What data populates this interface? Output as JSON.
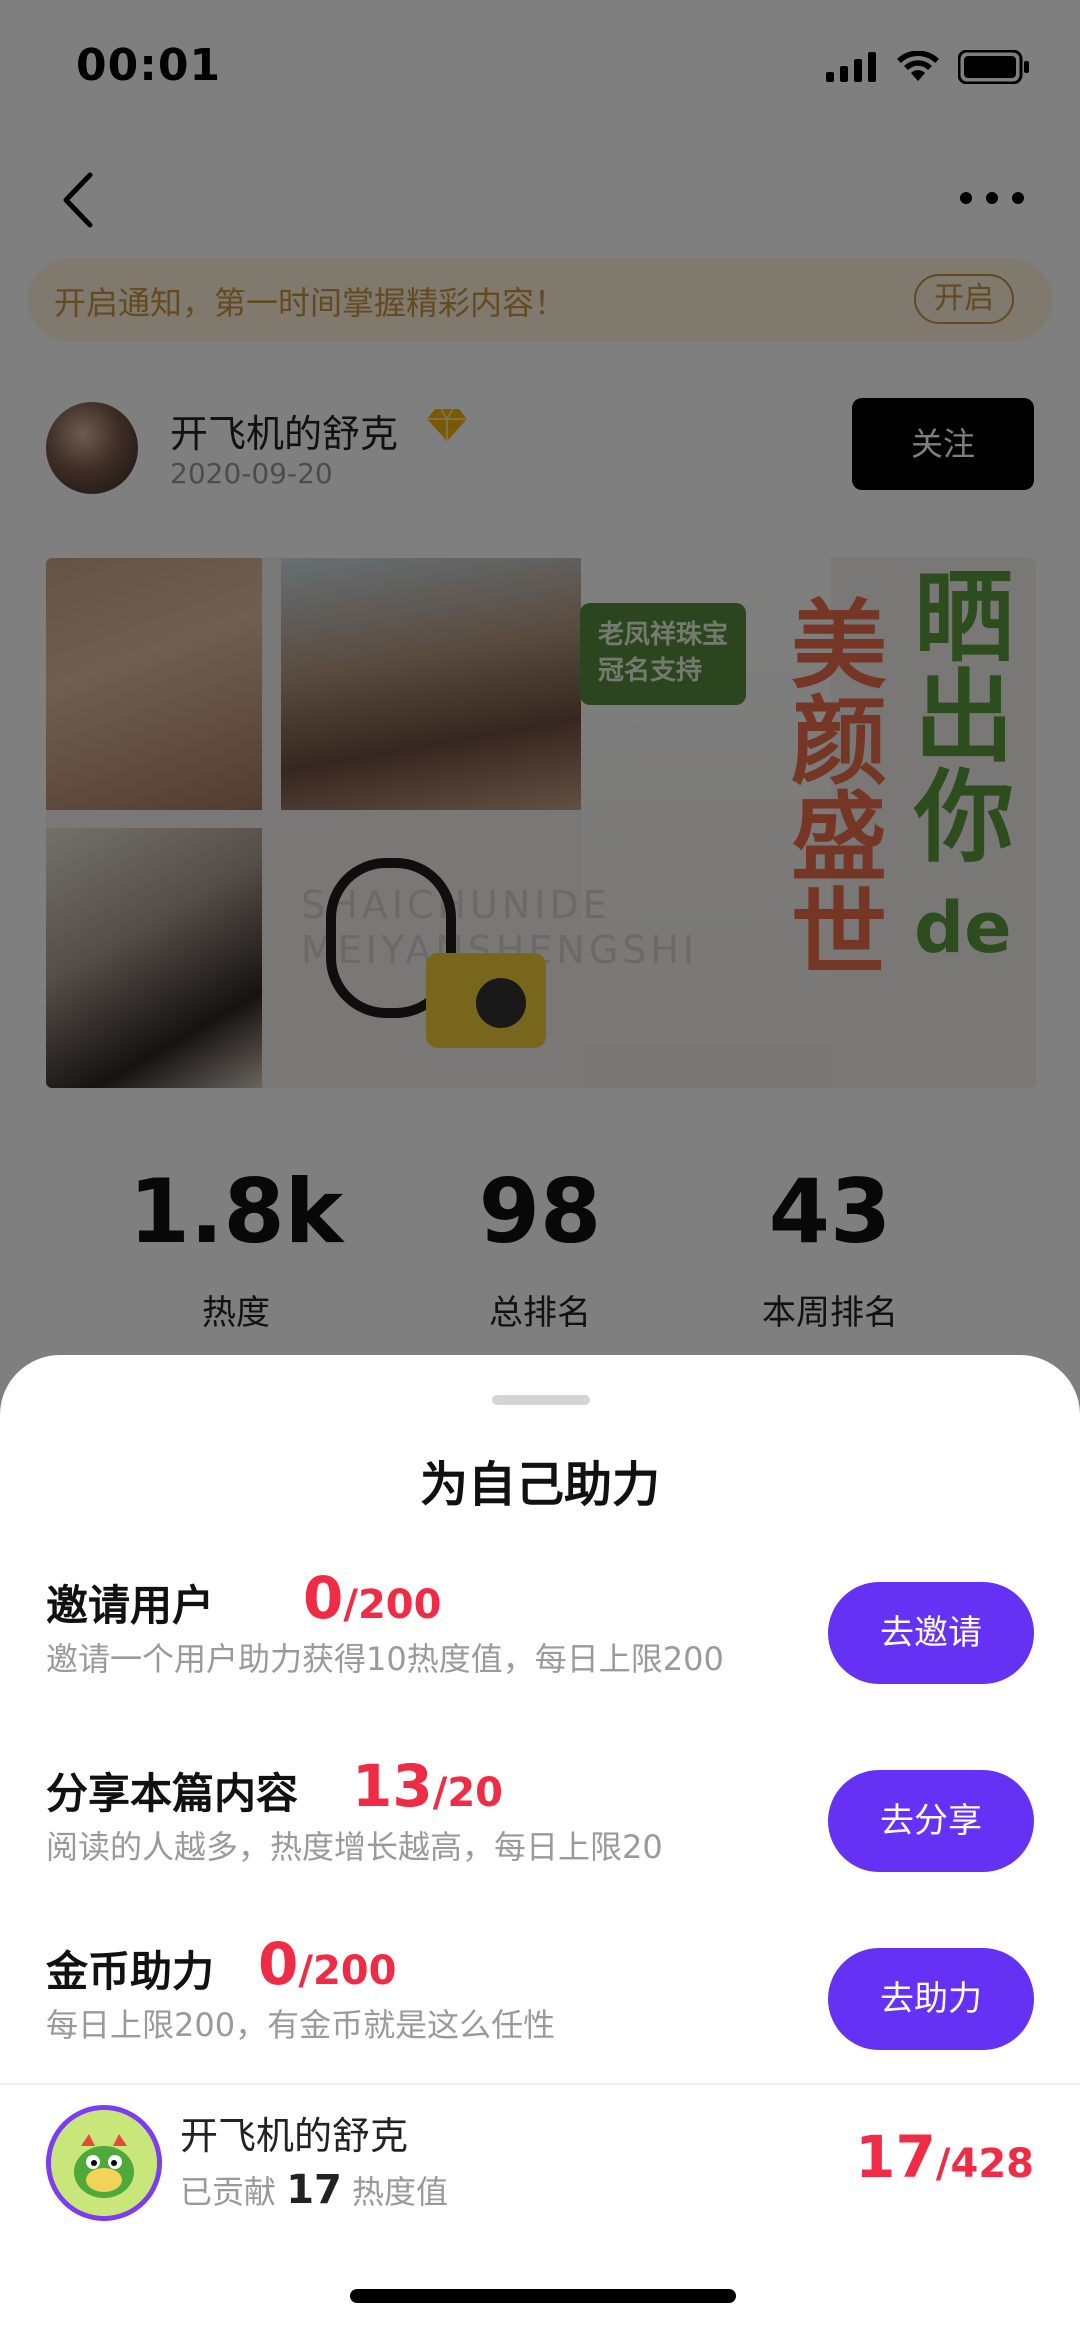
{
  "status": {
    "time": "00:01"
  },
  "notice": {
    "text": "开启通知，第一时间掌握精彩内容！",
    "button": "开启"
  },
  "author": {
    "name": "开飞机的舒克",
    "date": "2020-09-20",
    "follow": "关注"
  },
  "banner": {
    "sponsor": [
      "老凤祥珠宝",
      "冠名支持"
    ],
    "red_text": "美颜盛世",
    "green_text": "晒出你",
    "green_suffix": "de",
    "faint_line1": "SHAICHUNIDE",
    "faint_line2": "MEIYANSHENGSHI"
  },
  "stats": [
    {
      "value": "1.8k",
      "label": "热度"
    },
    {
      "value": "98",
      "label": "总排名"
    },
    {
      "value": "43",
      "label": "本周排名"
    }
  ],
  "sheet": {
    "title": "为自己助力",
    "tasks": [
      {
        "name": "邀请用户",
        "current": "0",
        "total": "/200",
        "desc": "邀请一个用户助力获得10热度值，每日上限200",
        "button": "去邀请"
      },
      {
        "name": "分享本篇内容",
        "current": "13",
        "total": "/20",
        "desc": "阅读的人越多，热度增长越高，每日上限20",
        "button": "去分享"
      },
      {
        "name": "金币助力",
        "current": "0",
        "total": "/200",
        "desc": "每日上限200，有金币就是这么任性",
        "button": "去助力"
      }
    ],
    "user": {
      "name": "开飞机的舒克",
      "contributed_prefix": "已贡献",
      "contributed_value": "17",
      "contributed_suffix": "热度值",
      "current": "17",
      "total": "/428"
    }
  },
  "colors": {
    "accent": "#6532f5",
    "highlight": "#f02b45",
    "notice": "#c69540"
  }
}
